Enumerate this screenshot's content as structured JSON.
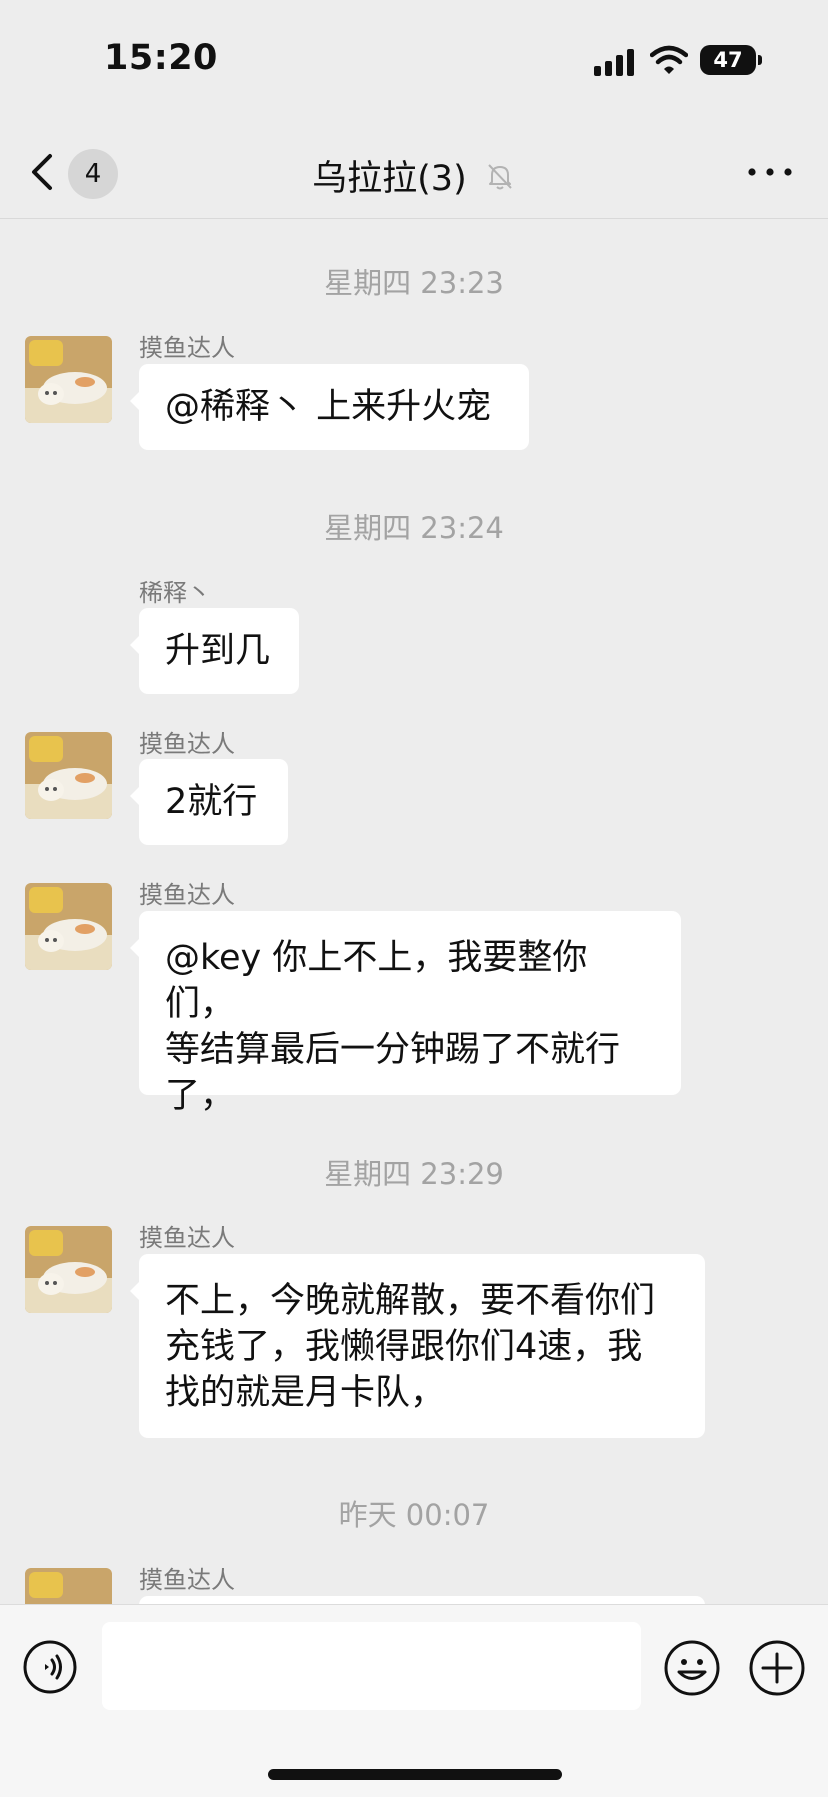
{
  "status_bar": {
    "time": "15:20",
    "battery": "47"
  },
  "nav": {
    "unread_count": "4",
    "title": "乌拉拉(3)"
  },
  "timestamps": [
    "星期四 23:23",
    "星期四 23:24",
    "星期四 23:29",
    "昨天 00:07"
  ],
  "messages": [
    {
      "sender": "摸鱼达人",
      "text": "@稀释丶 上来升火宠"
    },
    {
      "sender": "稀释丶",
      "text": "升到几"
    },
    {
      "sender": "摸鱼达人",
      "text": "2就行"
    },
    {
      "sender": "摸鱼达人",
      "lines": [
        "@key 你上不上，我要整你们，",
        "等结算最后一分钟踢了不就行",
        "了，"
      ]
    },
    {
      "sender": "摸鱼达人",
      "lines": [
        "不上，今晚就解散，要不看你们",
        "充钱了，我懒得跟你们4速，我",
        "找的就是月卡队，"
      ]
    },
    {
      "sender": "摸鱼达人"
    }
  ],
  "input": {
    "value": "",
    "placeholder": ""
  },
  "colors": {
    "background": "#ededed",
    "bubble": "#ffffff",
    "timestamp": "#a3a3a3",
    "sender": "#7a7a7a"
  }
}
